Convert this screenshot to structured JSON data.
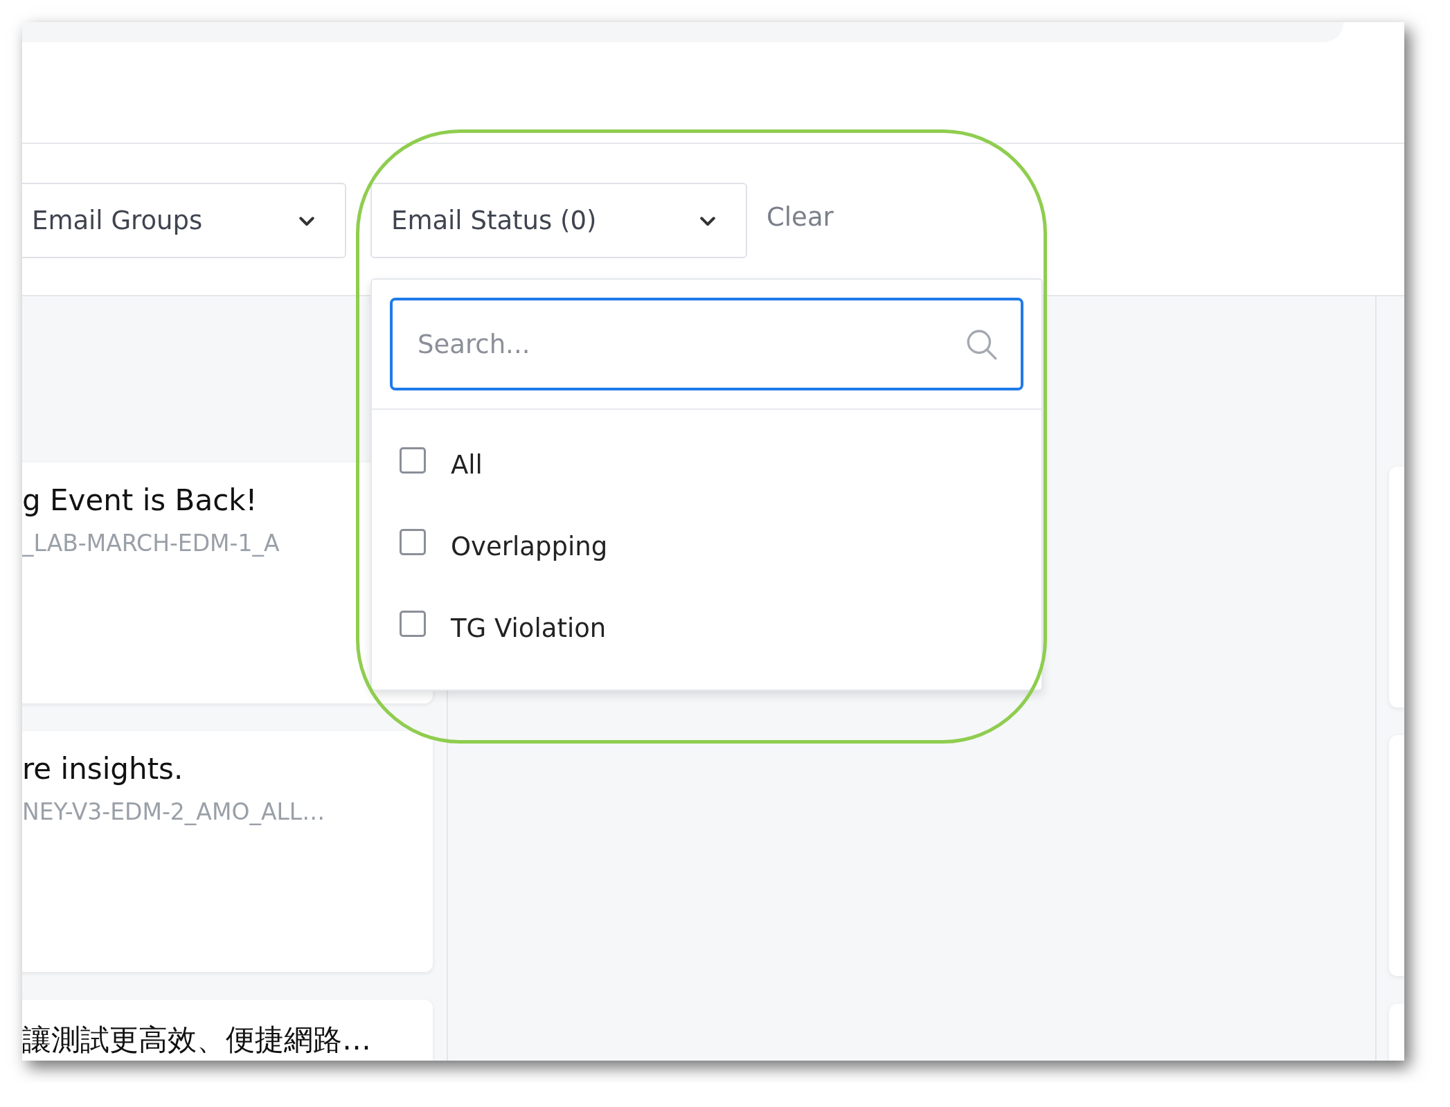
{
  "filters": [
    {
      "label": "Email Groups"
    },
    {
      "label": "Email Status (0)"
    }
  ],
  "clear": "Clear",
  "dropdown": {
    "search": {
      "placeholder": "Search..."
    },
    "options": [
      {
        "label": "All",
        "checked": false
      },
      {
        "label": "Overlapping",
        "checked": false
      },
      {
        "label": "TG Violation",
        "checked": false
      }
    ]
  },
  "cards": [
    {
      "title": "g Event is Back!",
      "code": "_LAB-MARCH-EDM-1_A"
    },
    {
      "title": "re insights.",
      "code": "NEY-V3-EDM-2_AMO_ALL…"
    },
    {
      "title": "讓測試更高效、便捷網路…"
    }
  ]
}
